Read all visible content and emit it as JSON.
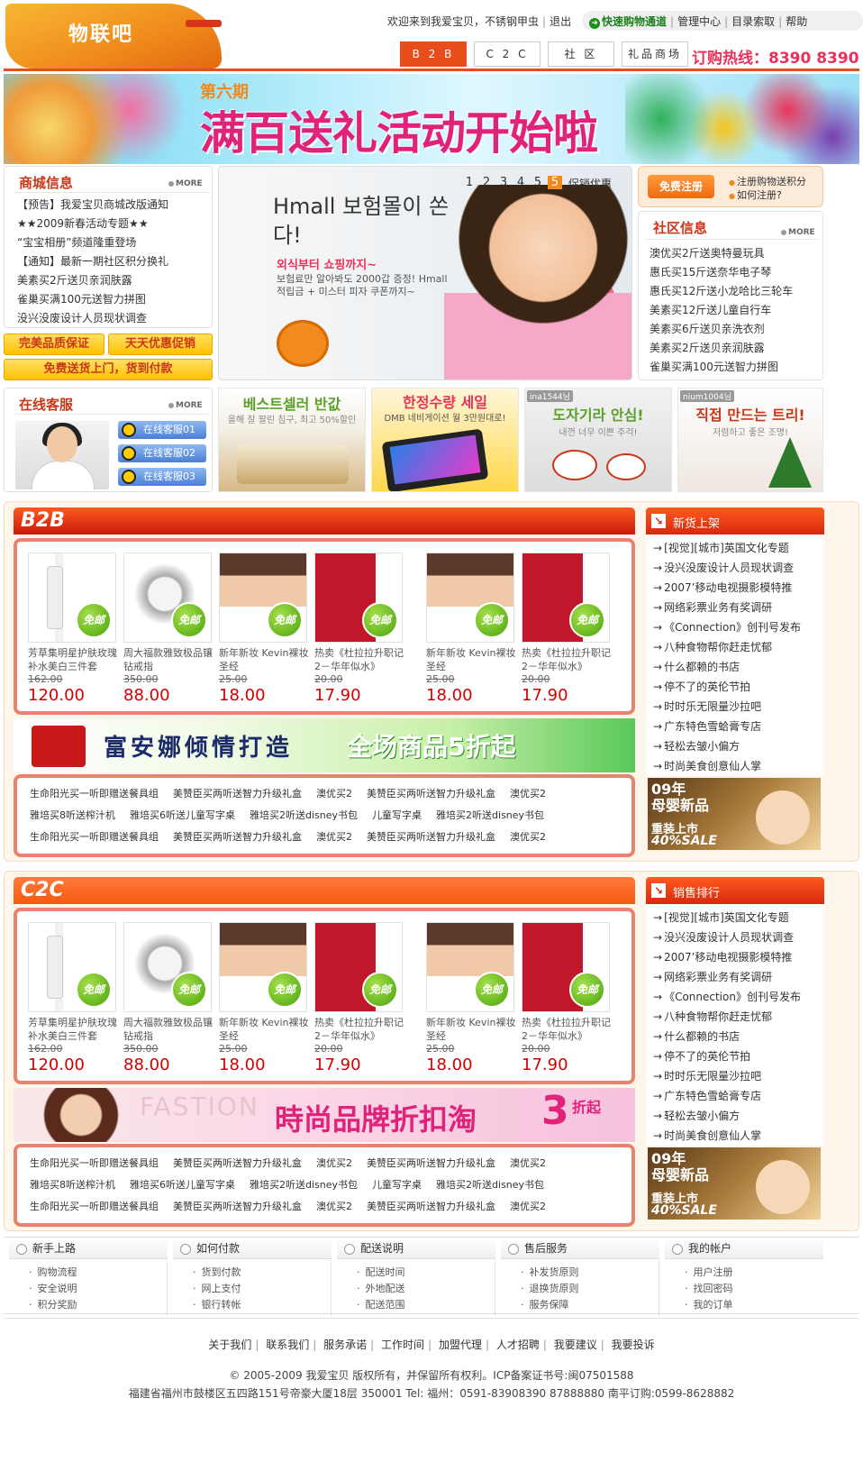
{
  "header": {
    "logo_text": "物联吧",
    "welcome": "欢迎来到我爱宝贝，不锈钢甲虫",
    "logout": "退出",
    "quick_shop": "快速购物通道",
    "admin": "管理中心",
    "catalog": "目录索取",
    "help": "帮助",
    "tabs": [
      "B 2 B",
      "C 2 C",
      "社 区",
      "礼品商场"
    ],
    "hotline": "订购热线：8390 8390"
  },
  "banner": {
    "sub": "第六期",
    "main": "满百送礼活动开始啦"
  },
  "mall_info": {
    "title": "商城信息",
    "more": "MORE",
    "items": [
      "【预告】我爱宝贝商城改版通知",
      "★★2009新春活动专题★★",
      "“宝宝相册”频道隆重登场",
      "【通知】最新一期社区积分换礼",
      "美素买2斤送贝亲润肤露",
      "雀巢买满100元送智力拼图",
      "没兴没废设计人员现状调查"
    ]
  },
  "promo_buttons": [
    "完美品质保证",
    "天天优惠促销",
    "免费送货上门，货到付款"
  ],
  "online_service": {
    "title": "在线客服",
    "more": "MORE",
    "buttons": [
      "在线客服01",
      "在线客服02",
      "在线客服03"
    ]
  },
  "slider": {
    "headline": "Hmall 보험몰이 쏜다!",
    "sub1": "외식부터 쇼핑까지~",
    "sub2": "보험료만 알아봐도 2000갑 증정! Hmall 적립금 + 미스터 피자 쿠폰까지~",
    "pages": [
      "1",
      "2",
      "3",
      "4",
      "5"
    ],
    "active_page": "5",
    "promo_label": "促销优惠"
  },
  "register": {
    "button": "免费注册",
    "line1": "注册购物送积分",
    "line2": "如何注册?"
  },
  "community": {
    "title": "社区信息",
    "more": "MORE",
    "items": [
      "澳优买2斤送奥特曼玩具",
      "惠氏买15斤送奈华电子琴",
      "惠氏买12斤送小龙哈比三轮车",
      "美素买12斤送儿童自行车",
      "美素买6斤送贝亲洗衣剂",
      "美素买2斤送贝亲润肤露",
      "雀巢买满100元送智力拼图"
    ]
  },
  "ads": [
    {
      "title": "베스트셀러 반값",
      "sub": "올해 잘 팔린 침구, 최고 50%할인",
      "tag": ""
    },
    {
      "title": "한정수량 세일",
      "sub": "DMB 네비게이션 월 3만원대로!",
      "tag": ""
    },
    {
      "title": "도자기라 안심!",
      "sub": "내껀 너무 이쁜 주걱!",
      "tag": "ina1544님"
    },
    {
      "title": "직접 만드는 트리!",
      "sub": "저렴하고 좋은 조명!",
      "tag": "nium1004님"
    }
  ],
  "b2b": {
    "label": "B2B",
    "free_badge": "免邮",
    "products": [
      {
        "name": "芳草集明星护肤玫瑰补水美白三件套",
        "old": "162.00",
        "price": "120.00"
      },
      {
        "name": "周大福款雅致极品镶钻戒指",
        "old": "350.00",
        "price": "88.00"
      },
      {
        "name": "新年新妆 Kevin裸妆圣经",
        "old": "25.00",
        "price": "18.00"
      },
      {
        "name": "热卖《杜拉拉升职记2－华年似水》",
        "old": "20.00",
        "price": "17.90"
      },
      {
        "name": "新年新妆 Kevin裸妆圣经",
        "old": "25.00",
        "price": "18.00"
      },
      {
        "name": "热卖《杜拉拉升职记2－华年似水》",
        "old": "20.00",
        "price": "17.90"
      }
    ],
    "ad_brand": "富安娜倾情打造",
    "ad_sale": "全场商品5折起",
    "links": [
      [
        "生命阳光买一听即赠送餐具组",
        "美赞臣买两听送智力升级礼盒",
        "澳优买2",
        "美赞臣买两听送智力升级礼盒",
        "澳优买2"
      ],
      [
        "雅培买8听送榨汁机",
        "雅培买6听送儿童写字桌",
        "雅培买2听送disney书包",
        "儿童写字桌",
        "雅培买2听送disney书包"
      ],
      [
        "生命阳光买一听即赠送餐具组",
        "美赞臣买两听送智力升级礼盒",
        "澳优买2",
        "美赞臣买两听送智力升级礼盒",
        "澳优买2"
      ]
    ]
  },
  "c2c": {
    "label": "C2C",
    "free_badge": "免邮",
    "products": [
      {
        "name": "芳草集明星护肤玫瑰补水美白三件套",
        "old": "162.00",
        "price": "120.00"
      },
      {
        "name": "周大福款雅致极品镶钻戒指",
        "old": "350.00",
        "price": "88.00"
      },
      {
        "name": "新年新妆 Kevin裸妆圣经",
        "old": "25.00",
        "price": "18.00"
      },
      {
        "name": "热卖《杜拉拉升职记2－华年似水》",
        "old": "20.00",
        "price": "17.90"
      },
      {
        "name": "新年新妆 Kevin裸妆圣经",
        "old": "25.00",
        "price": "18.00"
      },
      {
        "name": "热卖《杜拉拉升职记2－华年似水》",
        "old": "20.00",
        "price": "17.90"
      }
    ],
    "ad_bg": "FASTION",
    "ad_main": "時尚品牌折扣淘",
    "ad_num": "3",
    "ad_unit": "折起",
    "links": [
      [
        "生命阳光买一听即赠送餐具组",
        "美赞臣买两听送智力升级礼盒",
        "澳优买2",
        "美赞臣买两听送智力升级礼盒",
        "澳优买2"
      ],
      [
        "雅培买8听送榨汁机",
        "雅培买6听送儿童写字桌",
        "雅培买2听送disney书包",
        "儿童写字桌",
        "雅培买2听送disney书包"
      ],
      [
        "生命阳光买一听即赠送餐具组",
        "美赞臣买两听送智力升级礼盒",
        "澳优买2",
        "美赞臣买两听送智力升级礼盒",
        "澳优买2"
      ]
    ]
  },
  "new_arrivals": {
    "title": "新货上架",
    "items": [
      "[视觉][城市]英国文化专题",
      "没兴没废设计人员现状调查",
      "2007’移动电视摄影模特推",
      "网络彩票业务有奖调研",
      "《Connection》创刊号发布",
      "八种食物帮你赶走忧郁",
      "什么都赖的书店",
      "停不了的英伦节拍",
      "时时乐无限量沙拉吧",
      "广东特色雪蛤膏专店",
      "轻松去皱小偏方",
      "时尚美食创意仙人掌"
    ]
  },
  "sales_rank": {
    "title": "销售排行",
    "items": [
      "[视觉][城市]英国文化专题",
      "没兴没废设计人员现状调查",
      "2007’移动电视摄影模特推",
      "网络彩票业务有奖调研",
      "《Connection》创刊号发布",
      "八种食物帮你赶走忧郁",
      "什么都赖的书店",
      "停不了的英伦节拍",
      "时时乐无限量沙拉吧",
      "广东特色雪蛤膏专店",
      "轻松去皱小偏方",
      "时尚美食创意仙人掌"
    ]
  },
  "baby_ad": {
    "year": "09年",
    "title": "母婴新品",
    "sub": "重装上市",
    "pct": "40%SALE"
  },
  "help": [
    {
      "title": "新手上路",
      "items": [
        "购物流程",
        "安全说明",
        "积分奖励"
      ]
    },
    {
      "title": "如何付款",
      "items": [
        "货到付款",
        "网上支付",
        "银行转帐"
      ]
    },
    {
      "title": "配送说明",
      "items": [
        "配送时间",
        "外地配送",
        "配送范围"
      ]
    },
    {
      "title": "售后服务",
      "items": [
        "补发货原则",
        "退换货原则",
        "服务保障"
      ]
    },
    {
      "title": "我的帐户",
      "items": [
        "用户注册",
        "找回密码",
        "我的订单"
      ]
    }
  ],
  "footer": {
    "links": [
      "关于我们",
      "联系我们",
      "服务承诺",
      "工作时间",
      "加盟代理",
      "人才招聘",
      "我要建议",
      "我要投诉"
    ],
    "copyright": "© 2005-2009 我爱宝贝 版权所有，并保留所有权利。ICP备案证书号:闽07501588",
    "address": "福建省福州市鼓楼区五四路151号帝豪大厦18层 350001 Tel: 福州：0591-83908390 87888880 南平订购:0599-8628882"
  }
}
